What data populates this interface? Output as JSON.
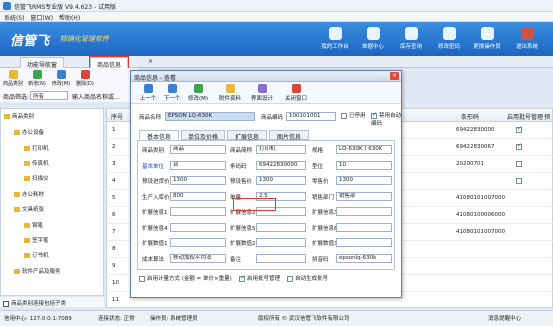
{
  "app": {
    "title": "信管飞RMS专业版 V9.4.623 - 试用版"
  },
  "menu": [
    "系统(S)",
    "窗口(W)",
    "帮助(H)"
  ],
  "banner": {
    "brand": "信管飞",
    "slogan": "精确化管理软件",
    "buttons": [
      "我的工作台",
      "单据中心",
      "库存查询",
      "修改密码",
      "更换操作员",
      "退出系统"
    ]
  },
  "tabs": [
    "功能导航窗",
    "商品信息"
  ],
  "left_toolbar": [
    "商品类别",
    "新增(N)",
    "修改(M)",
    "删除(D)"
  ],
  "filter": {
    "label": "商品筛选:",
    "value": "所有",
    "hint": "输入商品名称或..."
  },
  "tree": [
    {
      "label": "商品类别",
      "level": 0
    },
    {
      "label": "办公设备",
      "level": 1
    },
    {
      "label": "打印机",
      "level": 2
    },
    {
      "label": "传真机",
      "level": 2
    },
    {
      "label": "扫描仪",
      "level": 2
    },
    {
      "label": "办公耗材",
      "level": 1
    },
    {
      "label": "文具纸张",
      "level": 1
    },
    {
      "label": "钢笔",
      "level": 2
    },
    {
      "label": "签字笔",
      "level": 2
    },
    {
      "label": "订书机",
      "level": 2
    },
    {
      "label": "软件产品及服务",
      "level": 1
    }
  ],
  "tree_footer": "商品类别连接包括子类",
  "grid": {
    "headers": [
      "序号",
      "条形码",
      "启用批号管理",
      "预"
    ],
    "rows": [
      {
        "no": "1",
        "barcode": "69422830000",
        "batch": true
      },
      {
        "no": "2",
        "barcode": "69422830067",
        "batch": true
      },
      {
        "no": "3",
        "barcode": "20200701",
        "batch": false
      },
      {
        "no": "4",
        "barcode": "",
        "batch": false
      },
      {
        "no": "5",
        "barcode": "41080101007000",
        "batch": false
      },
      {
        "no": "6",
        "barcode": "41080100006000",
        "batch": false
      },
      {
        "no": "7",
        "barcode": "41080101007000",
        "batch": false
      },
      {
        "no": "8",
        "barcode": "",
        "batch": false
      },
      {
        "no": "9",
        "barcode": "",
        "batch": false
      },
      {
        "no": "10",
        "barcode": "",
        "batch": false
      },
      {
        "no": "11",
        "barcode": "",
        "batch": false
      }
    ]
  },
  "dialog": {
    "title": "商品信息 - 查看",
    "toolbar": [
      "上一个",
      "下一个",
      "修改(M)",
      "附件资料",
      "界面设计",
      "关闭窗口"
    ],
    "name_label": "商品名称",
    "name_value": "EPSON LQ-630K",
    "code_label": "商品编码",
    "code_value": "100101001",
    "disabled_label": "已停用",
    "autocode_label": "禁用自动编码",
    "tabs": [
      "基本信息",
      "单位及价格",
      "扩展信息",
      "图片信息"
    ],
    "fields": [
      {
        "l": "商品类别",
        "v": "商品",
        "l2": "商品简称",
        "v2": "打印机",
        "l3": "规格",
        "v3": "LQ-630K ( 630K"
      },
      {
        "l": "基本单位",
        "v": "台",
        "l2": "条码码",
        "v2": "69422830000",
        "l3": "型位",
        "v3": "10"
      },
      {
        "l": "预设进货价",
        "v": "1300",
        "l2": "预设售价",
        "v2": "1300",
        "l3": "零售价",
        "v3": "1300"
      },
      {
        "l": "生产入库价",
        "v": "800",
        "l2": "单量",
        "v2": "2.5",
        "l3": "销售部门",
        "v3": "销售部"
      },
      {
        "l": "扩展信息1",
        "v": "",
        "l2": "扩展信息2",
        "v2": "",
        "l3": "扩展信息3",
        "v3": ""
      },
      {
        "l": "扩展信息4",
        "v": "",
        "l2": "扩展信息5",
        "v2": "",
        "l3": "扩展信息6",
        "v3": ""
      },
      {
        "l": "扩展数值1",
        "v": "",
        "l2": "扩展数值2",
        "v2": "",
        "l3": "扩展数值3",
        "v3": ""
      },
      {
        "l": "成本算法",
        "v": "移动加权平均法",
        "l2": "备注",
        "v2": "",
        "l3": "拼音码",
        "v3": "epsonlq-630k"
      }
    ],
    "options": [
      "启用计量方式 (金额 = 单价×重量)",
      "启用批号管理",
      "自动生成批号"
    ]
  },
  "status": [
    "信用中心: 127.0.0.1:7089",
    "连接状态: 正常",
    "操作员: 系统管理员",
    "版权所有 © 武汉信管飞软件有限公司",
    "消息提醒中心"
  ]
}
